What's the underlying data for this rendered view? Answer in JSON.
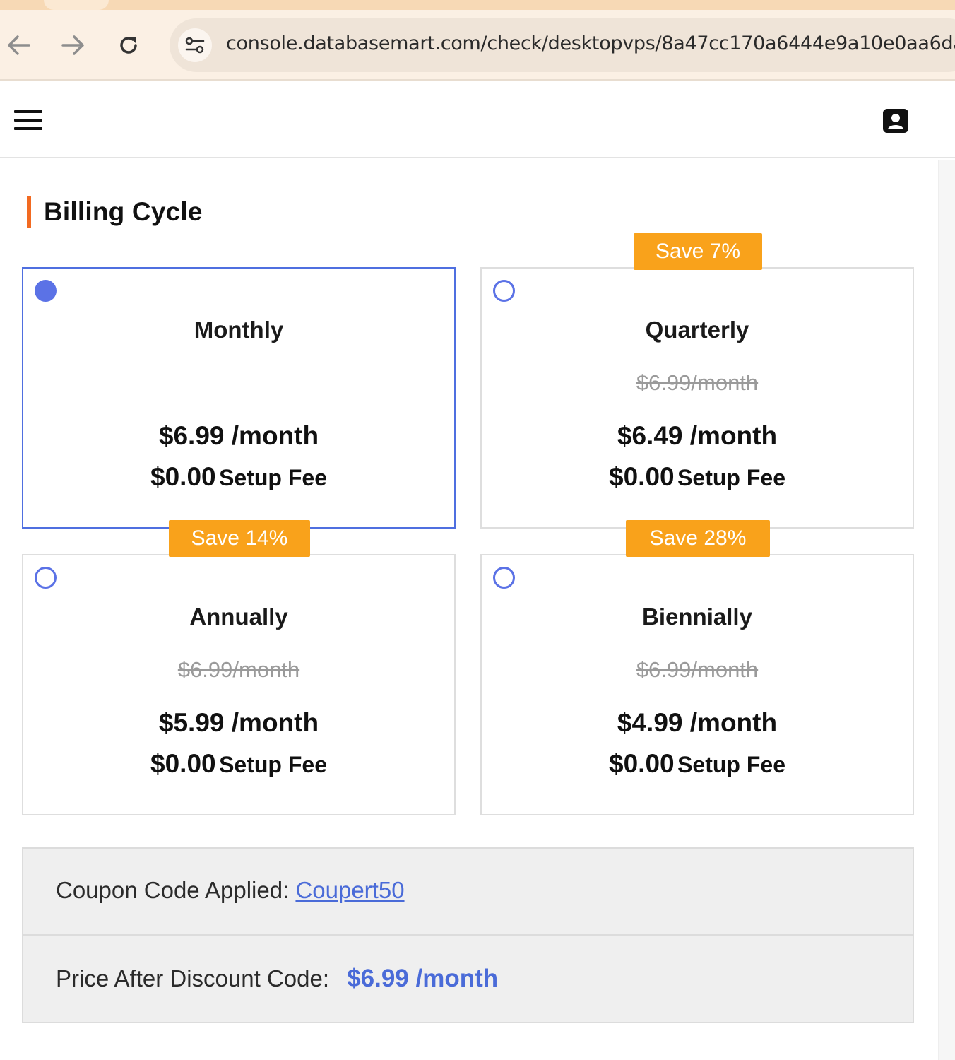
{
  "browser": {
    "url": "console.databasemart.com/check/desktopvps/8a47cc170a6444e9a10e0aa6da"
  },
  "section": {
    "title": "Billing Cycle"
  },
  "plans": [
    {
      "name": "Monthly",
      "original_price": "",
      "price": "$6.99 /month",
      "setup_amount": "$0.00",
      "setup_label": "Setup Fee",
      "badge": "",
      "selected": true
    },
    {
      "name": "Quarterly",
      "original_price": "$6.99/month",
      "price": "$6.49 /month",
      "setup_amount": "$0.00",
      "setup_label": "Setup Fee",
      "badge": "Save 7%",
      "selected": false
    },
    {
      "name": "Annually",
      "original_price": "$6.99/month",
      "price": "$5.99 /month",
      "setup_amount": "$0.00",
      "setup_label": "Setup Fee",
      "badge": "Save 14%",
      "selected": false
    },
    {
      "name": "Biennially",
      "original_price": "$6.99/month",
      "price": "$4.99 /month",
      "setup_amount": "$0.00",
      "setup_label": "Setup Fee",
      "badge": "Save 28%",
      "selected": false
    }
  ],
  "summary": {
    "coupon_label": "Coupon Code Applied:",
    "coupon_code": "Coupert50",
    "discount_label": "Price After Discount Code:",
    "discount_price": "$6.99 /month"
  },
  "colors": {
    "accent_blue": "#4f6fe0",
    "badge_orange": "#f9a21b",
    "title_bar_orange": "#f26a21"
  },
  "icons": [
    "back-arrow-icon",
    "forward-arrow-icon",
    "reload-icon",
    "site-settings-icon",
    "menu-icon",
    "account-icon"
  ]
}
